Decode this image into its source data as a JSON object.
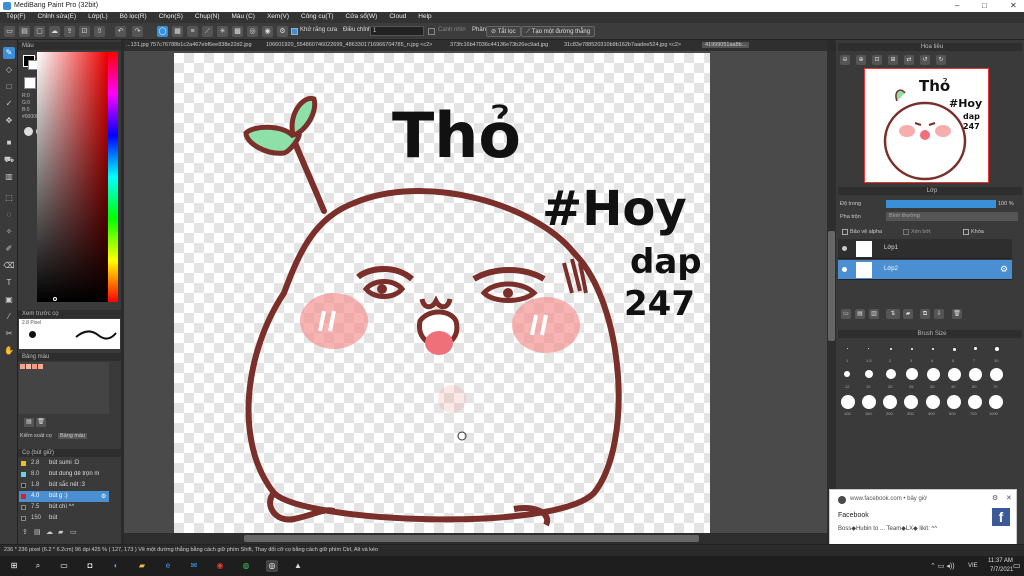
{
  "window": {
    "title": "MediBang Paint Pro (32bit)"
  },
  "menu": [
    "Tệp(F)",
    "Chỉnh sửa(E)",
    "Lớp(L)",
    "Bộ lọc(R)",
    "Chọn(S)",
    "Chụp(N)",
    "Màu (C)",
    "Xem(V)",
    "Công cụ(T)",
    "Cửa sổ(W)",
    "Cloud",
    "Help"
  ],
  "toolbar": {
    "anti_alias_label": "Khử răng cưa",
    "correction_label": "Điều chỉnh",
    "correction_value": "1",
    "snap_label": "Canh nhìn",
    "snap2_label": "Phân",
    "disable_label": "Tắt lọc",
    "create_line_label": "Tạo một đường thẳng"
  },
  "tabs": [
    "...131.jpg",
    "757c76788b1c2a467ebf6ee838e22d2.jpg",
    "106601920_554860746022699_4863301716966704785_n.jpg <c2>",
    "373fc16b47036c44136e73b26ec9ad.jpg",
    "31c83e788520310b9b162b7aadee524.jpg <c2>",
    "41999051aa8b..."
  ],
  "color_panel": {
    "title": "Màu",
    "r_label": "R:0",
    "g_label": "G:0",
    "b_label": "B:0",
    "hex": "#000000"
  },
  "brush_preview": {
    "title": "Xem trước cọ",
    "size": "2.8 Pixel"
  },
  "palette": {
    "title": "Bảng màu",
    "tab1": "Kiểm soát cọ",
    "tab2": "Bảng màu"
  },
  "brush_list": {
    "title": "Cọ (bút giữ)",
    "items": [
      {
        "size": "2.8",
        "name": "bút sumi :D",
        "color": "#f0c020"
      },
      {
        "size": "8.0",
        "name": "bút dùng để trộn m",
        "color": "#6cd0e0"
      },
      {
        "size": "1.8",
        "name": "bút sắc nét :3",
        "color": "#222222"
      },
      {
        "size": "4.0",
        "name": "bút g :)",
        "color": "#e02020",
        "selected": true
      },
      {
        "size": "7.5",
        "name": "bút chì ^^",
        "color": "#333333"
      },
      {
        "size": "150",
        "name": "bút",
        "color": "#333333"
      }
    ]
  },
  "navigator": {
    "title": "Hoa tiêu"
  },
  "layers": {
    "title": "Lớp",
    "opacity_label": "Độ trong",
    "opacity_value": "100 %",
    "blend_label": "Pha trộn",
    "blend_value": "Bình thường",
    "protect_alpha": "Bảo vệ alpha",
    "clipping": "Xén bớt",
    "lock": "Khóa",
    "items": [
      {
        "name": "Lớp1",
        "selected": false
      },
      {
        "name": "Lớp2",
        "selected": true
      }
    ]
  },
  "brush_size": {
    "title": "Brush Size",
    "row1": [
      ".",
      ".",
      ".",
      ".",
      ".",
      ".",
      ".",
      "."
    ],
    "row1_labels": [
      "1",
      "1.5",
      "2",
      "3",
      "4",
      "5",
      "7",
      "10"
    ],
    "row2_labels": [
      "12",
      "15",
      "20",
      "25",
      "30",
      "40",
      "50",
      "70"
    ],
    "row3_labels": [
      "100",
      "150",
      "200",
      "300",
      "400",
      "500",
      "700",
      "1000"
    ]
  },
  "status": {
    "text": "236 * 236 pixel   (6.2 * 6.2cm)   96 dpi   425 %   ( 127, 173 )   Vẽ một đường thẳng bằng cách giữ phím Shift, Thay đổi cỡ cọ bằng cách giữ phím Ctrl, Alt và kéo"
  },
  "artwork": {
    "title_text": "Thỏ",
    "hashtag_text": "#Hoy",
    "sub1": "dap",
    "sub2": "247"
  },
  "toast": {
    "source": "www.facebook.com • bây giờ",
    "title": "Facebook",
    "body": "Boss◆Hubin to ... Team◆LX◆ likit: ^^"
  },
  "taskbar": {
    "time": "11:37 AM",
    "date": "7/7/2021",
    "lang": "VIE"
  },
  "colors": {
    "accent": "#3a8fd9",
    "selected_layer": "#4a8fd1",
    "line": "#7a2f2a",
    "blush": "#f48a8a"
  }
}
